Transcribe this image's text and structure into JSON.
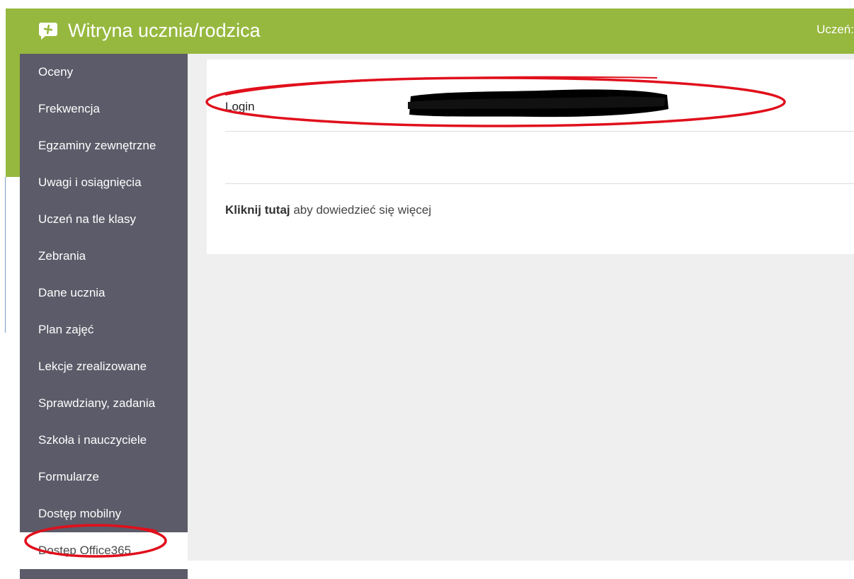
{
  "header": {
    "title": "Witryna ucznia/rodzica",
    "user_label": "Uczeń:",
    "icon": "chat-plus-icon",
    "brand_color": "#96b83f"
  },
  "sidebar": {
    "background": "#5b5b69",
    "items": [
      {
        "label": "Oceny"
      },
      {
        "label": "Frekwencja"
      },
      {
        "label": "Egzaminy zewnętrzne"
      },
      {
        "label": "Uwagi i osiągnięcia"
      },
      {
        "label": "Uczeń na tle klasy"
      },
      {
        "label": "Zebrania"
      },
      {
        "label": "Dane ucznia"
      },
      {
        "label": "Plan zajęć"
      },
      {
        "label": "Lekcje zrealizowane"
      },
      {
        "label": "Sprawdziany, zadania"
      },
      {
        "label": "Szkoła i nauczyciele"
      },
      {
        "label": "Formularze"
      },
      {
        "label": "Dostęp mobilny"
      },
      {
        "label": "Dostęp Office365",
        "active": true
      }
    ]
  },
  "content": {
    "login_label": "Login",
    "login_value_redacted": true,
    "info_link": "Kliknij tutaj",
    "info_text": " aby dowiedzieć się więcej"
  },
  "annotations": {
    "color": "#e0101c"
  }
}
